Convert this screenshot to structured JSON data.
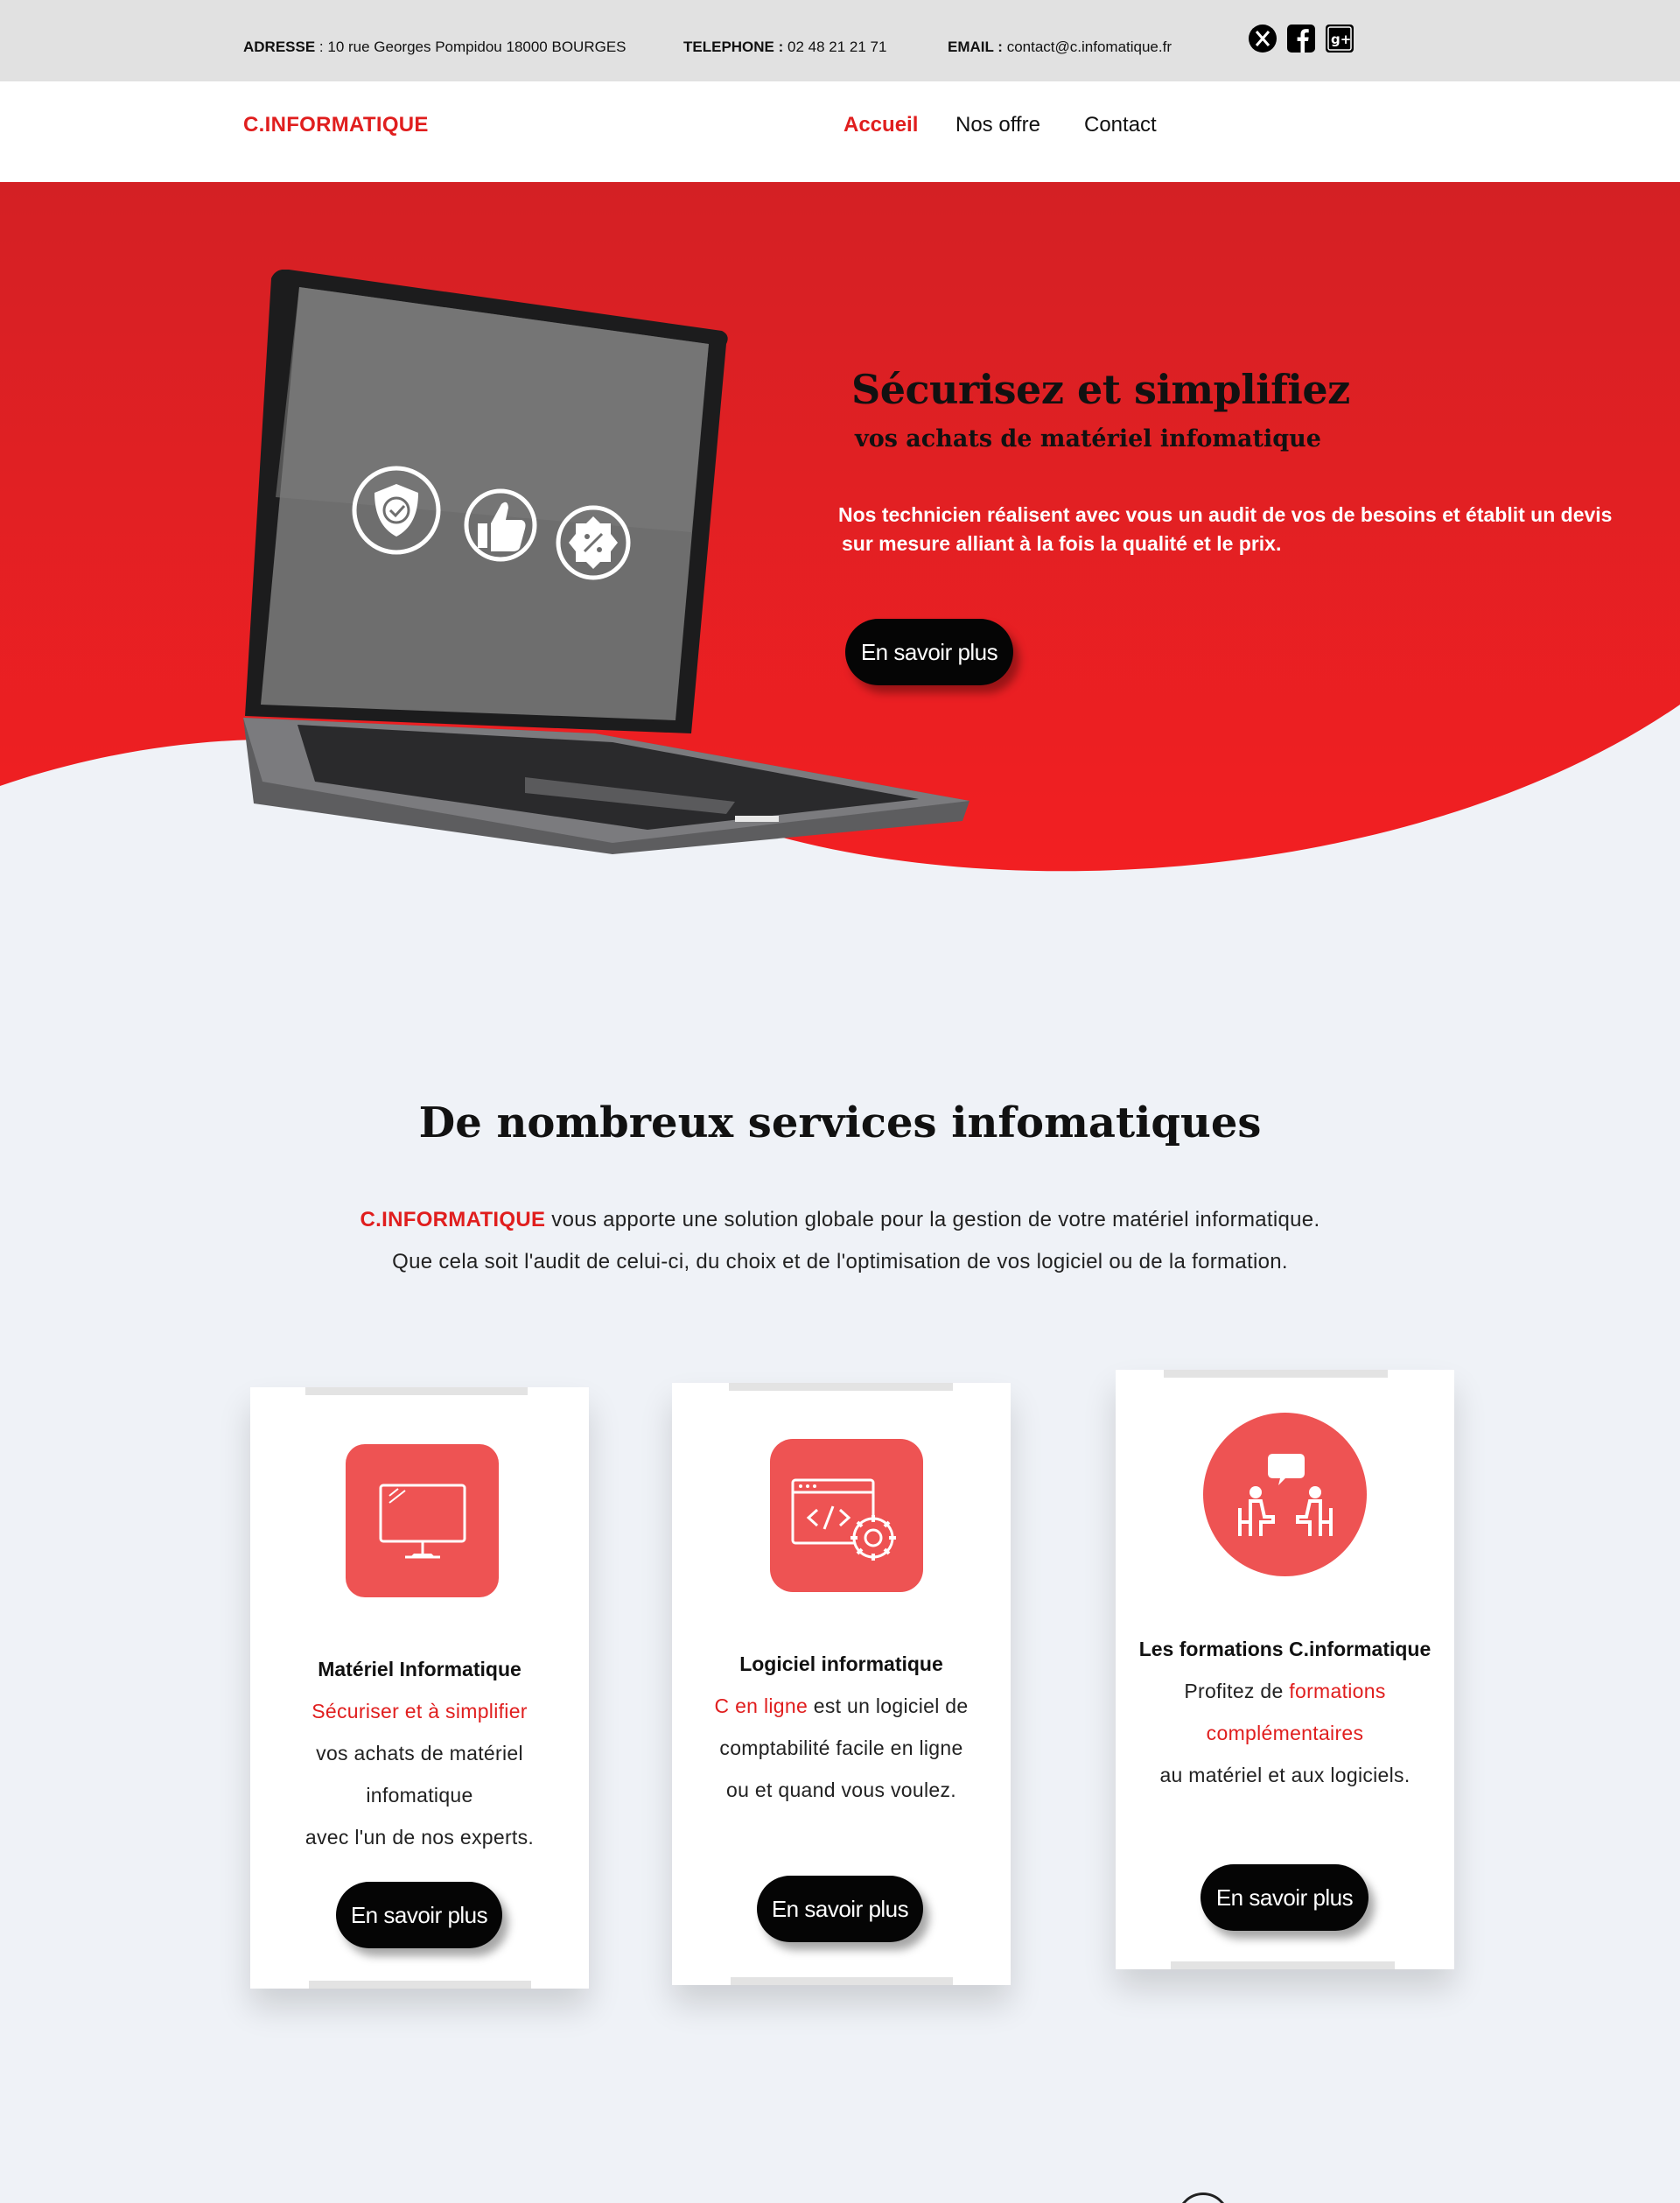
{
  "topbar": {
    "address_label": "ADRESSE",
    "address": "10 rue Georges Pompidou 18000 BOURGES",
    "phone_label": "TELEPHONE :",
    "phone": "02 48 21 21 71",
    "email_label": "EMAIL :",
    "email": "contact@c.infomatique.fr",
    "social_icons": [
      "x-icon",
      "facebook-icon",
      "google-plus-icon"
    ]
  },
  "nav": {
    "logo": "C.INFORMATIQUE",
    "links": [
      "Accueil",
      "Nos offre",
      "Contact"
    ],
    "active": "Accueil"
  },
  "hero": {
    "title": "Sécurisez et simplifiez",
    "subtitle": "vos achats de matériel infomatique",
    "desc_line1": "Nos technicien réalisent avec vous un audit de vos de besoins et établit un devis",
    "desc_line2": "sur mesure alliant à la fois la qualité et le prix.",
    "button": "En savoir plus",
    "laptop_icons": [
      "shield-check-icon",
      "thumbs-up-icon",
      "discount-badge-icon"
    ]
  },
  "services": {
    "title": "De nombreux services infomatiques",
    "intro_brand": "C.INFORMATIQUE",
    "intro_line1": "vous apporte une solution globale pour la gestion de votre matériel informatique.",
    "intro_line2": "Que cela soit l'audit de celui-ci, du choix et de l'optimisation de vos logiciel ou de la formation.",
    "cards": [
      {
        "icon": "monitor-icon",
        "title": "Matériel Informatique",
        "line1": "Sécuriser et à simplifier",
        "line2": "vos achats de matériel",
        "line3": "infomatique",
        "line4": "avec l'un de nos experts.",
        "button": "En savoir plus"
      },
      {
        "icon": "code-settings-icon",
        "title": "Logiciel informatique",
        "line1_red": "C en ligne",
        "line1_rest": " est un logiciel de",
        "line2": "comptabilité facile en ligne",
        "line3": "ou et quand vous voulez.",
        "button": "En savoir plus"
      },
      {
        "icon": "training-conversation-icon",
        "title": "Les formations C.informatique",
        "line1_pre": "Profitez de ",
        "line1_red": "formations",
        "line2_red": "complémentaires",
        "line3": "au matériel et aux logiciels.",
        "button": "En savoir plus"
      }
    ]
  },
  "colors": {
    "brand_red": "#e01e1e",
    "hero_red": "#e52226",
    "icon_red": "#ee5353",
    "button_black": "#050505",
    "page_bg": "#eff2f7",
    "topbar_bg": "#e1e1e1"
  }
}
